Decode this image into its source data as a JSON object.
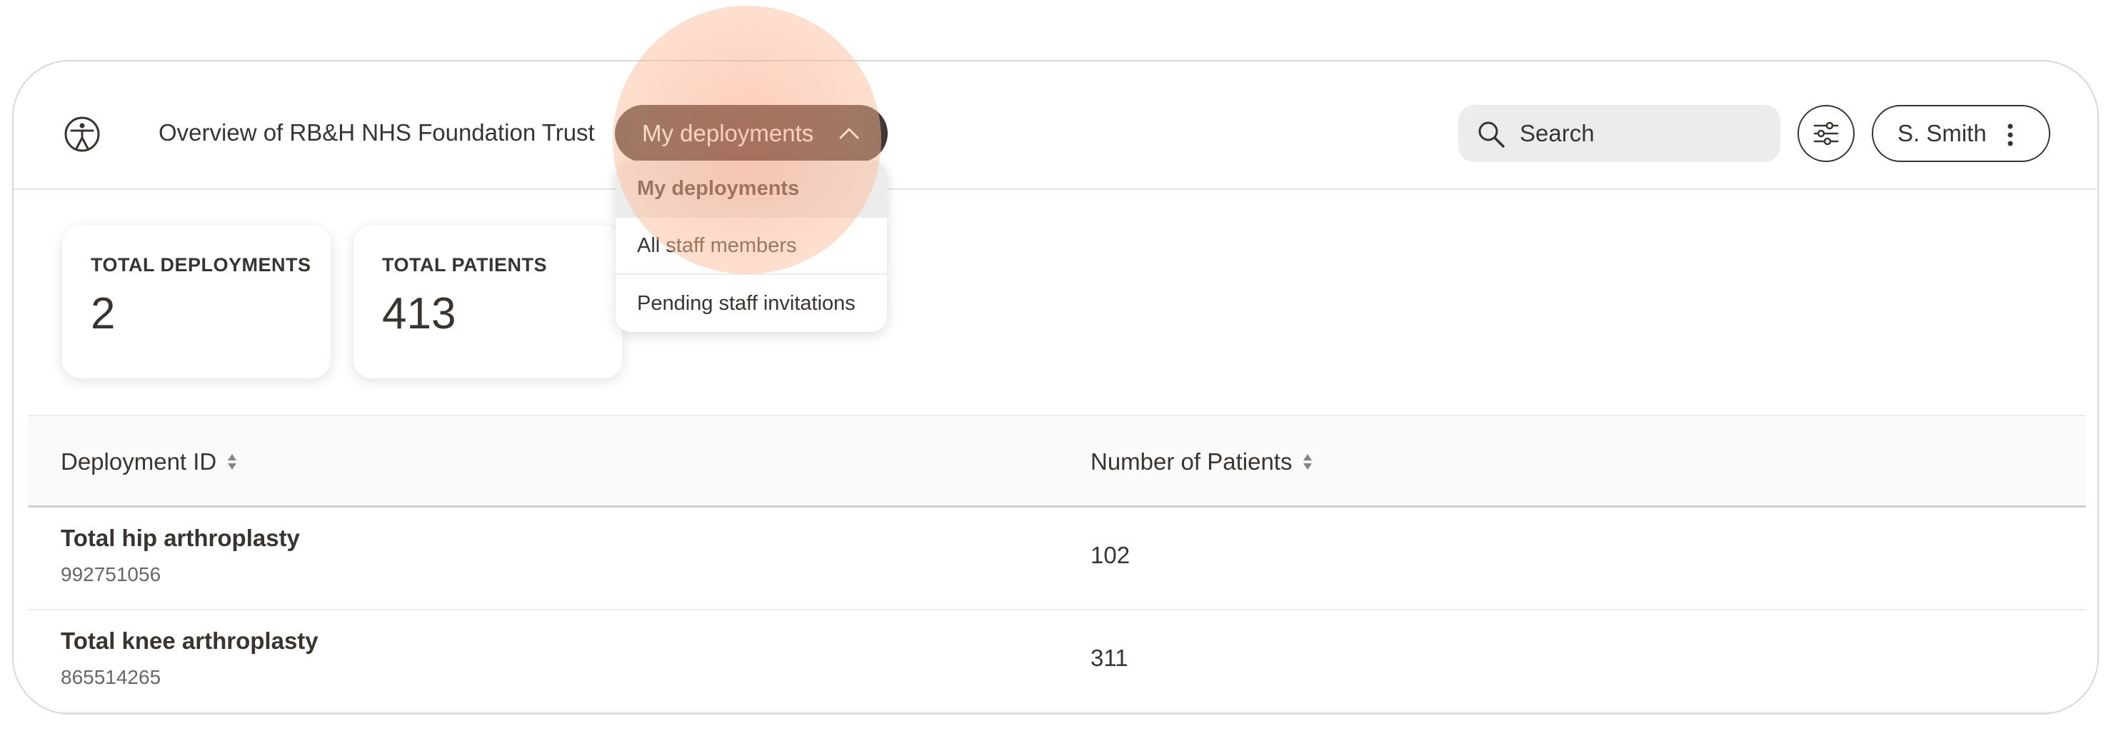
{
  "header": {
    "logo_icon": "accessibility-person-icon",
    "title": "Overview of RB&H NHS Foundation Trust",
    "nav_dropdown": {
      "label": "My deployments",
      "icon": "chevron-up-icon",
      "expanded": true
    },
    "search": {
      "placeholder": "Search",
      "value": "",
      "icon": "search-icon"
    },
    "filter_icon": "sliders-icon",
    "user": {
      "name": "S. Smith",
      "icon": "kebab-menu-icon"
    }
  },
  "nav_menu": {
    "items": [
      {
        "label": "My deployments",
        "selected": true
      },
      {
        "label": "All staff members",
        "selected": false
      },
      {
        "label": "Pending staff invitations",
        "selected": false
      }
    ]
  },
  "stats": [
    {
      "label": "TOTAL DEPLOYMENTS",
      "value": "2"
    },
    {
      "label": "TOTAL PATIENTS",
      "value": "413"
    }
  ],
  "table": {
    "columns": [
      {
        "label": "Deployment ID",
        "sort_icon": "sort-icon"
      },
      {
        "label": "Number of Patients",
        "sort_icon": "sort-icon"
      }
    ],
    "rows": [
      {
        "name": "Total hip arthroplasty",
        "id": "992751056",
        "patients": "102"
      },
      {
        "name": "Total knee arthroplasty",
        "id": "865514265",
        "patients": "311"
      }
    ]
  },
  "colors": {
    "nav_button_bg": "#433733",
    "text": "#3a3430",
    "touch_indicator": "#f9b596"
  }
}
